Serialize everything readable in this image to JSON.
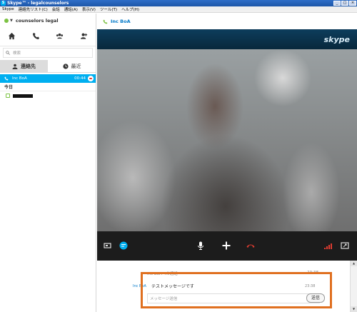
{
  "window": {
    "title": "Skype™ - legalcounselors",
    "controls": [
      "_",
      "□",
      "×"
    ]
  },
  "menu": [
    "Skype",
    "連絡先リスト(C)",
    "会話",
    "通話(A)",
    "表示(V)",
    "ツール(T)",
    "ヘルプ(H)"
  ],
  "profile": {
    "name": "counselors legal",
    "status_color": "#7cc242"
  },
  "actions": [
    {
      "icon": "home-icon"
    },
    {
      "icon": "phone-icon"
    },
    {
      "icon": "group-icon"
    },
    {
      "icon": "add-contact-icon"
    }
  ],
  "search": {
    "placeholder": "検索"
  },
  "tabs": [
    {
      "label": "連絡先",
      "active": true,
      "icon": "person-icon"
    },
    {
      "label": "最近",
      "active": false,
      "icon": "clock-icon"
    }
  ],
  "active_call": {
    "name": "Inc BoA",
    "duration": "00:44"
  },
  "recent": {
    "section_label": "今日"
  },
  "conversation": {
    "contact_name": "Inc BoA"
  },
  "video": {
    "logo": "skype"
  },
  "chat": {
    "previous": {
      "text": "Inc BoAへの通話",
      "time": "23:38"
    },
    "message": {
      "sender": "Inc BoA",
      "text": "テストメッセージです",
      "time": "23:38"
    },
    "input_placeholder": "メッセージ送信",
    "send_label": "送信"
  },
  "colors": {
    "accent": "#00aff0",
    "end_call": "#e03c31",
    "highlight": "#e07020",
    "video_band": "#0d3d5c"
  }
}
